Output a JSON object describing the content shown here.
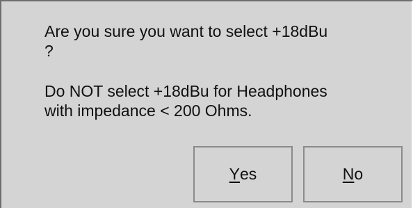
{
  "dialog": {
    "question_line1": "Are you sure you want to select +18dBu",
    "question_line2": "?",
    "warning_line1": "Do NOT select +18dBu for Headphones",
    "warning_line2": "with impedance < 200 Ohms.",
    "yes_button": {
      "mnemonic": "Y",
      "rest": "es"
    },
    "no_button": {
      "mnemonic": "N",
      "rest": "o"
    }
  },
  "colors": {
    "dialog_background": "#d4d4d4",
    "text": "#101010",
    "button_border": "#8a8a8a"
  }
}
